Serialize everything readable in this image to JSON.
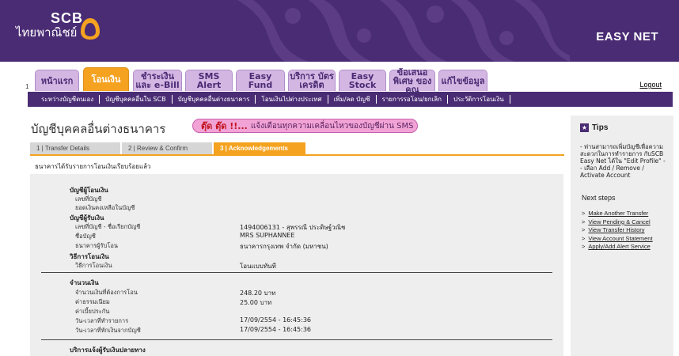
{
  "header": {
    "brand_en": "SCB",
    "brand_th": "ไทยพาณิชย์",
    "product": "EASY NET"
  },
  "tabs": {
    "index_number": "1",
    "items": [
      {
        "label": "หน้าแรก"
      },
      {
        "label": "โอนเงิน"
      },
      {
        "label": "ชำระเงิน และ e-Bill"
      },
      {
        "label": "SMS Alert"
      },
      {
        "label": "Easy Fund"
      },
      {
        "label": "บริการ บัตรเครดิต"
      },
      {
        "label": "Easy Stock"
      },
      {
        "label": "ข้อเสนอพิเศษ ของคุณ"
      },
      {
        "label": "แก้ไขข้อมูล"
      }
    ],
    "logout": "Logout"
  },
  "subnav": [
    "ระหว่างบัญชีตนเอง",
    "บัญชีบุคคลอื่นใน SCB",
    "บัญชีบุคคลอื่นต่างธนาคาร",
    "โอนเงินไปต่างประเทศ",
    "เพิ่ม/ลด บัญชี",
    "รายการรอโอน/ยกเลิก",
    "ประวัติการโอนเงิน"
  ],
  "page": {
    "title": "บัญชีบุคคลอื่นต่างธนาคาร",
    "promo_highlight": "ตุ๊ด ตุ๊ด !!...",
    "promo_text": "แจ้งเตือนทุกความเคลื่อนไหวของบัญชีผ่าน SMS"
  },
  "steps": {
    "step1": "1 | Transfer Details",
    "step2": "2 | Review & Confirm",
    "step3": "3 | Acknowledgements"
  },
  "confirm_message": "ธนาคารได้รับรายการโอนเงินเรียบร้อยแล้ว",
  "details": {
    "from_title": "บัญชีผู้โอนเงิน",
    "from_account_label": "เลขที่บัญชี",
    "from_balance_label": "ยอดเงินคงเหลือในบัญชี",
    "to_title": "บัญชีผู้รับเงิน",
    "to_account_label": "เลขที่บัญชี - ชื่อเรียกบัญชี",
    "to_account_value": "1494006131 - สุพรรณี ประดิษฐ์วณิช",
    "to_name_label": "ชื่อบัญชี",
    "to_name_value": "MRS SUPHANNEE",
    "to_bank_label": "ธนาคารผู้รับโอน",
    "to_bank_value": "ธนาคารกรุงเทพ จำกัด (มหาชน)",
    "method_title": "วิธีการโอนเงิน",
    "method_label": "วิธีการโอนเงิน",
    "method_value": "โอนแบบทันที",
    "amount_title": "จำนวนเงิน",
    "amount_label": "จำนวนเงินที่ต้องการโอน",
    "amount_value": "248.20 บาท",
    "fee_label": "ค่าธรรมเนียม",
    "fee_value": "25.00 บาท",
    "interest_label": "ค่าเบี้ยประกัน",
    "txn_date_label": "วัน-เวลาที่ทำรายการ",
    "txn_date_value": "17/09/2554 - 16:45:36",
    "debit_date_label": "วัน-เวลาที่หักเงินจากบัญชี",
    "debit_date_value": "17/09/2554 - 16:45:36",
    "notify_title": "บริการแจ้งผู้รับเงินปลายทาง"
  },
  "tips": {
    "title": "Tips",
    "text": "- ท่านสามารถเพิ่มบัญชีเพื่อความสะดวกในการทำรายการ กับSCB Easy Net ได้ใน \"Edit Profile\" -- เลือก Add / Remove / Activate Account",
    "next_steps_title": "Next steps",
    "next_steps": [
      "Make Another Transfer",
      "View Pending & Cancel",
      "View Transfer History",
      "View Account Statement",
      "Apply/Add Alert Service"
    ]
  },
  "colors": {
    "brand_purple": "#4a2c74",
    "accent_orange": "#f4a21f",
    "tab_lilac": "#d4b6e3",
    "promo_pink": "#f2a3d6"
  }
}
